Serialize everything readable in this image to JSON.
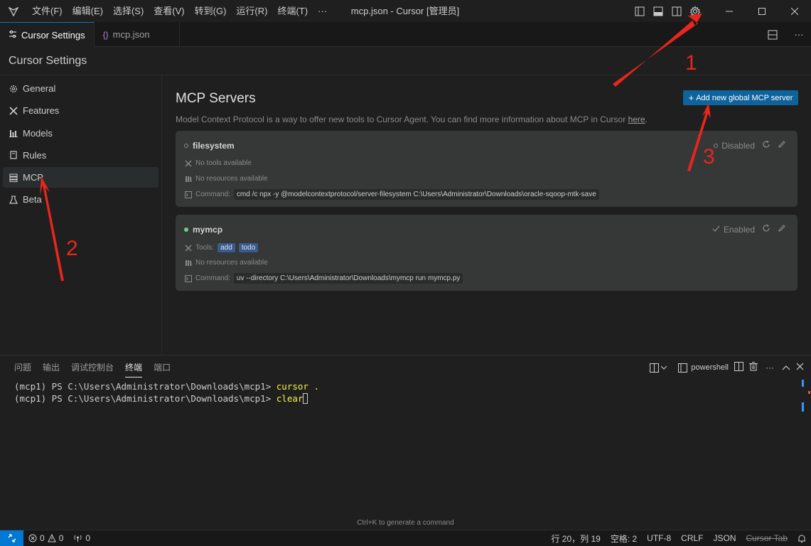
{
  "titlebar": {
    "menus": [
      "文件(F)",
      "编辑(E)",
      "选择(S)",
      "查看(V)",
      "转到(G)",
      "运行(R)",
      "终端(T)",
      "···"
    ],
    "window_title": "mcp.json - Cursor [管理员]"
  },
  "tabs": [
    {
      "label": "Cursor Settings",
      "icon": "settings-sliders-icon"
    },
    {
      "label": "mcp.json",
      "icon": "braces-icon"
    }
  ],
  "settings": {
    "header": "Cursor Settings",
    "sidebar": [
      {
        "label": "General",
        "icon": "gear-icon"
      },
      {
        "label": "Features",
        "icon": "tools-icon"
      },
      {
        "label": "Models",
        "icon": "chart-bars-icon"
      },
      {
        "label": "Rules",
        "icon": "book-icon"
      },
      {
        "label": "MCP",
        "icon": "server-icon"
      },
      {
        "label": "Beta",
        "icon": "flask-icon"
      }
    ]
  },
  "mcp": {
    "title": "MCP Servers",
    "description": "Model Context Protocol is a way to offer new tools to Cursor Agent. You can find more information about MCP in Cursor",
    "link": "here",
    "period": ".",
    "add_button": "Add new global MCP server",
    "servers": [
      {
        "name": "filesystem",
        "status": "Disabled",
        "tools_text": "No tools available",
        "resources_text": "No resources available",
        "command_label": "Command:",
        "command": "cmd /c npx -y @modelcontextprotocol/server-filesystem C:\\Users\\Administrator\\Downloads\\oracle-sqoop-mtk-save"
      },
      {
        "name": "mymcp",
        "status": "Enabled",
        "tools_label": "Tools:",
        "tools": [
          "add",
          "todo"
        ],
        "resources_text": "No resources available",
        "command_label": "Command:",
        "command": "uv --directory C:\\Users\\Administrator\\Downloads\\mymcp run mymcp.py"
      }
    ]
  },
  "panel": {
    "tabs": [
      "问题",
      "输出",
      "调试控制台",
      "终端",
      "端口"
    ],
    "active_tab": "终端",
    "shell": "powershell",
    "terminal": [
      {
        "prompt": "(mcp1) PS C:\\Users\\Administrator\\Downloads\\mcp1> ",
        "cmd": "cursor ."
      },
      {
        "prompt": "(mcp1) PS C:\\Users\\Administrator\\Downloads\\mcp1> ",
        "cmd": "clear"
      }
    ],
    "hint": "Ctrl+K to generate a command"
  },
  "statusbar": {
    "errors": "0",
    "warnings": "0",
    "ports": "0",
    "position": "行 20，列 19",
    "indent": "空格: 2",
    "encoding": "UTF-8",
    "eol": "CRLF",
    "language": "JSON",
    "cursor_tab": "Cursor Tab"
  },
  "annotations": [
    "1",
    "2",
    "3"
  ],
  "colors": {
    "accent": "#0078d4",
    "button": "#0e639c",
    "annotation_red": "#e8261c",
    "enabled_dot": "#73c991",
    "terminal_cmd": "#f5f543"
  }
}
